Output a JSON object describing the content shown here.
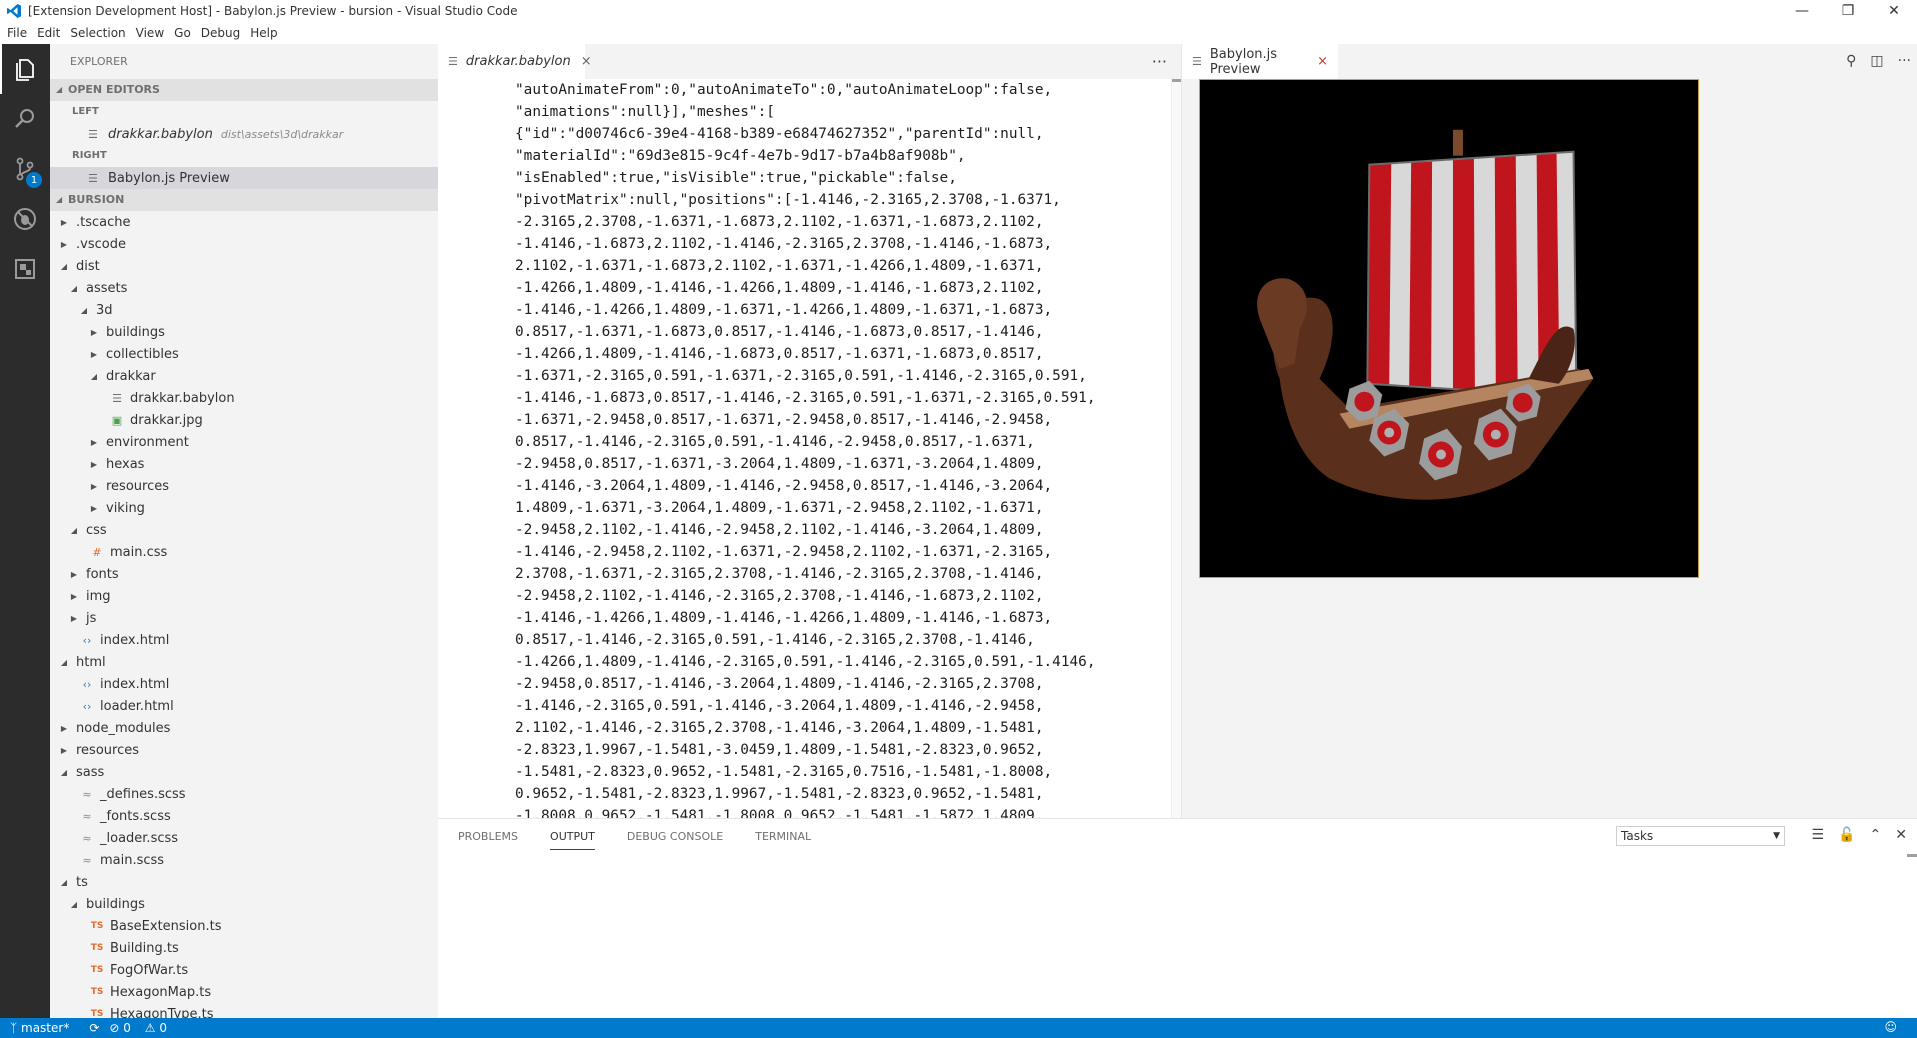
{
  "window": {
    "title": "[Extension Development Host] - Babylon.js Preview - bursion - Visual Studio Code",
    "controls": [
      "minimize",
      "restore",
      "close"
    ]
  },
  "menu": [
    "File",
    "Edit",
    "Selection",
    "View",
    "Go",
    "Debug",
    "Help"
  ],
  "activity_bar": {
    "items": [
      {
        "name": "explorer-icon"
      },
      {
        "name": "search-icon"
      },
      {
        "name": "source-control-icon",
        "badge": "1"
      },
      {
        "name": "debug-icon"
      },
      {
        "name": "extensions-icon"
      }
    ]
  },
  "sidebar": {
    "title": "EXPLORER",
    "open_editors": {
      "header": "OPEN EDITORS",
      "groups": [
        {
          "label": "LEFT",
          "items": [
            {
              "name": "drakkar.babylon",
              "path": "dist\\assets\\3d\\drakkar"
            }
          ]
        },
        {
          "label": "RIGHT",
          "items": [
            {
              "name": "Babylon.js Preview",
              "path": ""
            }
          ]
        }
      ]
    },
    "project": {
      "header": "BURSION",
      "tree": [
        {
          "label": ".tscache",
          "depth": 0,
          "type": "folder",
          "open": false
        },
        {
          "label": ".vscode",
          "depth": 0,
          "type": "folder",
          "open": false
        },
        {
          "label": "dist",
          "depth": 0,
          "type": "folder",
          "open": true
        },
        {
          "label": "assets",
          "depth": 1,
          "type": "folder",
          "open": true
        },
        {
          "label": "3d",
          "depth": 2,
          "type": "folder",
          "open": true
        },
        {
          "label": "buildings",
          "depth": 3,
          "type": "folder",
          "open": false
        },
        {
          "label": "collectibles",
          "depth": 3,
          "type": "folder",
          "open": false
        },
        {
          "label": "drakkar",
          "depth": 3,
          "type": "folder",
          "open": true
        },
        {
          "label": "drakkar.babylon",
          "depth": 4,
          "type": "file",
          "icon": "lines"
        },
        {
          "label": "drakkar.jpg",
          "depth": 4,
          "type": "file",
          "icon": "image"
        },
        {
          "label": "environment",
          "depth": 3,
          "type": "folder",
          "open": false
        },
        {
          "label": "hexas",
          "depth": 3,
          "type": "folder",
          "open": false
        },
        {
          "label": "resources",
          "depth": 3,
          "type": "folder",
          "open": false
        },
        {
          "label": "viking",
          "depth": 3,
          "type": "folder",
          "open": false
        },
        {
          "label": "css",
          "depth": 1,
          "type": "folder",
          "open": true
        },
        {
          "label": "main.css",
          "depth": 2,
          "type": "file",
          "icon": "hash"
        },
        {
          "label": "fonts",
          "depth": 1,
          "type": "folder",
          "open": false
        },
        {
          "label": "img",
          "depth": 1,
          "type": "folder",
          "open": false
        },
        {
          "label": "js",
          "depth": 1,
          "type": "folder",
          "open": false
        },
        {
          "label": "index.html",
          "depth": 1,
          "type": "file",
          "icon": "html"
        },
        {
          "label": "html",
          "depth": 0,
          "type": "folder",
          "open": true
        },
        {
          "label": "index.html",
          "depth": 1,
          "type": "file",
          "icon": "html"
        },
        {
          "label": "loader.html",
          "depth": 1,
          "type": "file",
          "icon": "html"
        },
        {
          "label": "node_modules",
          "depth": 0,
          "type": "folder",
          "open": false
        },
        {
          "label": "resources",
          "depth": 0,
          "type": "folder",
          "open": false
        },
        {
          "label": "sass",
          "depth": 0,
          "type": "folder",
          "open": true
        },
        {
          "label": "_defines.scss",
          "depth": 1,
          "type": "file",
          "icon": "sass"
        },
        {
          "label": "_fonts.scss",
          "depth": 1,
          "type": "file",
          "icon": "sass"
        },
        {
          "label": "_loader.scss",
          "depth": 1,
          "type": "file",
          "icon": "sass"
        },
        {
          "label": "main.scss",
          "depth": 1,
          "type": "file",
          "icon": "sass"
        },
        {
          "label": "ts",
          "depth": 0,
          "type": "folder",
          "open": true
        },
        {
          "label": "buildings",
          "depth": 1,
          "type": "folder",
          "open": true
        },
        {
          "label": "BaseExtension.ts",
          "depth": 2,
          "type": "file",
          "icon": "ts"
        },
        {
          "label": "Building.ts",
          "depth": 2,
          "type": "file",
          "icon": "ts"
        },
        {
          "label": "FogOfWar.ts",
          "depth": 2,
          "type": "file",
          "icon": "ts"
        },
        {
          "label": "HexagonMap.ts",
          "depth": 2,
          "type": "file",
          "icon": "ts"
        },
        {
          "label": "HexagonType.ts",
          "depth": 2,
          "type": "file",
          "icon": "ts"
        }
      ]
    }
  },
  "editor_left": {
    "tab": {
      "label": "drakkar.babylon",
      "close": "×"
    },
    "more": "···",
    "code_lines": [
      "\"autoAnimateFrom\":0,\"autoAnimateTo\":0,\"autoAnimateLoop\":false,",
      "\"animations\":null}],\"meshes\":[",
      "{\"id\":\"d00746c6-39e4-4168-b389-e68474627352\",\"parentId\":null,",
      "\"materialId\":\"69d3e815-9c4f-4e7b-9d17-b7a4b8af908b\",",
      "\"isEnabled\":true,\"isVisible\":true,\"pickable\":false,",
      "\"pivotMatrix\":null,\"positions\":[-1.4146,-2.3165,2.3708,-1.6371,",
      "-2.3165,2.3708,-1.6371,-1.6873,2.1102,-1.6371,-1.6873,2.1102,",
      "-1.4146,-1.6873,2.1102,-1.4146,-2.3165,2.3708,-1.4146,-1.6873,",
      "2.1102,-1.6371,-1.6873,2.1102,-1.6371,-1.4266,1.4809,-1.6371,",
      "-1.4266,1.4809,-1.4146,-1.4266,1.4809,-1.4146,-1.6873,2.1102,",
      "-1.4146,-1.4266,1.4809,-1.6371,-1.4266,1.4809,-1.6371,-1.6873,",
      "0.8517,-1.6371,-1.6873,0.8517,-1.4146,-1.6873,0.8517,-1.4146,",
      "-1.4266,1.4809,-1.4146,-1.6873,0.8517,-1.6371,-1.6873,0.8517,",
      "-1.6371,-2.3165,0.591,-1.6371,-2.3165,0.591,-1.4146,-2.3165,0.591,",
      "-1.4146,-1.6873,0.8517,-1.4146,-2.3165,0.591,-1.6371,-2.3165,0.591,",
      "-1.6371,-2.9458,0.8517,-1.6371,-2.9458,0.8517,-1.4146,-2.9458,",
      "0.8517,-1.4146,-2.3165,0.591,-1.4146,-2.9458,0.8517,-1.6371,",
      "-2.9458,0.8517,-1.6371,-3.2064,1.4809,-1.6371,-3.2064,1.4809,",
      "-1.4146,-3.2064,1.4809,-1.4146,-2.9458,0.8517,-1.4146,-3.2064,",
      "1.4809,-1.6371,-3.2064,1.4809,-1.6371,-2.9458,2.1102,-1.6371,",
      "-2.9458,2.1102,-1.4146,-2.9458,2.1102,-1.4146,-3.2064,1.4809,",
      "-1.4146,-2.9458,2.1102,-1.6371,-2.9458,2.1102,-1.6371,-2.3165,",
      "2.3708,-1.6371,-2.3165,2.3708,-1.4146,-2.3165,2.3708,-1.4146,",
      "-2.9458,2.1102,-1.4146,-2.3165,2.3708,-1.4146,-1.6873,2.1102,",
      "-1.4146,-1.4266,1.4809,-1.4146,-1.4266,1.4809,-1.4146,-1.6873,",
      "0.8517,-1.4146,-2.3165,0.591,-1.4146,-2.3165,2.3708,-1.4146,",
      "-1.4266,1.4809,-1.4146,-2.3165,0.591,-1.4146,-2.3165,0.591,-1.4146,",
      "-2.9458,0.8517,-1.4146,-3.2064,1.4809,-1.4146,-2.3165,2.3708,",
      "-1.4146,-2.3165,0.591,-1.4146,-3.2064,1.4809,-1.4146,-2.9458,",
      "2.1102,-1.4146,-2.3165,2.3708,-1.4146,-3.2064,1.4809,-1.5481,",
      "-2.8323,1.9967,-1.5481,-3.0459,1.4809,-1.5481,-2.8323,0.9652,",
      "-1.5481,-2.8323,0.9652,-1.5481,-2.3165,0.7516,-1.5481,-1.8008,",
      "0.9652,-1.5481,-2.8323,1.9967,-1.5481,-2.8323,0.9652,-1.5481,",
      "-1.8008,0.9652,-1.5481,-1.8008,0.9652,-1.5481,-1.5872,1.4809,"
    ]
  },
  "editor_right": {
    "tab": {
      "label": "Babylon.js Preview",
      "close": "×"
    },
    "actions": [
      "open-preview-icon",
      "split-editor-icon",
      "more-icon"
    ]
  },
  "panel": {
    "tabs": [
      {
        "label": "PROBLEMS",
        "active": false
      },
      {
        "label": "OUTPUT",
        "active": true
      },
      {
        "label": "DEBUG CONSOLE",
        "active": false
      },
      {
        "label": "TERMINAL",
        "active": false
      }
    ],
    "select_value": "Tasks",
    "actions": [
      "clear-output-icon",
      "lock-scroll-icon",
      "maximize-panel-icon",
      "close-panel-icon"
    ]
  },
  "status_bar": {
    "branch": "master*",
    "errors": "0",
    "warnings": "0"
  },
  "colors": {
    "activity_bg": "#2c2c2c",
    "sidebar_bg": "#f3f3f3",
    "status_bg": "#007acc",
    "sail_red": "#c0151d",
    "sail_white": "#d8d8d8",
    "hull_brown": "#5a2f1c"
  }
}
